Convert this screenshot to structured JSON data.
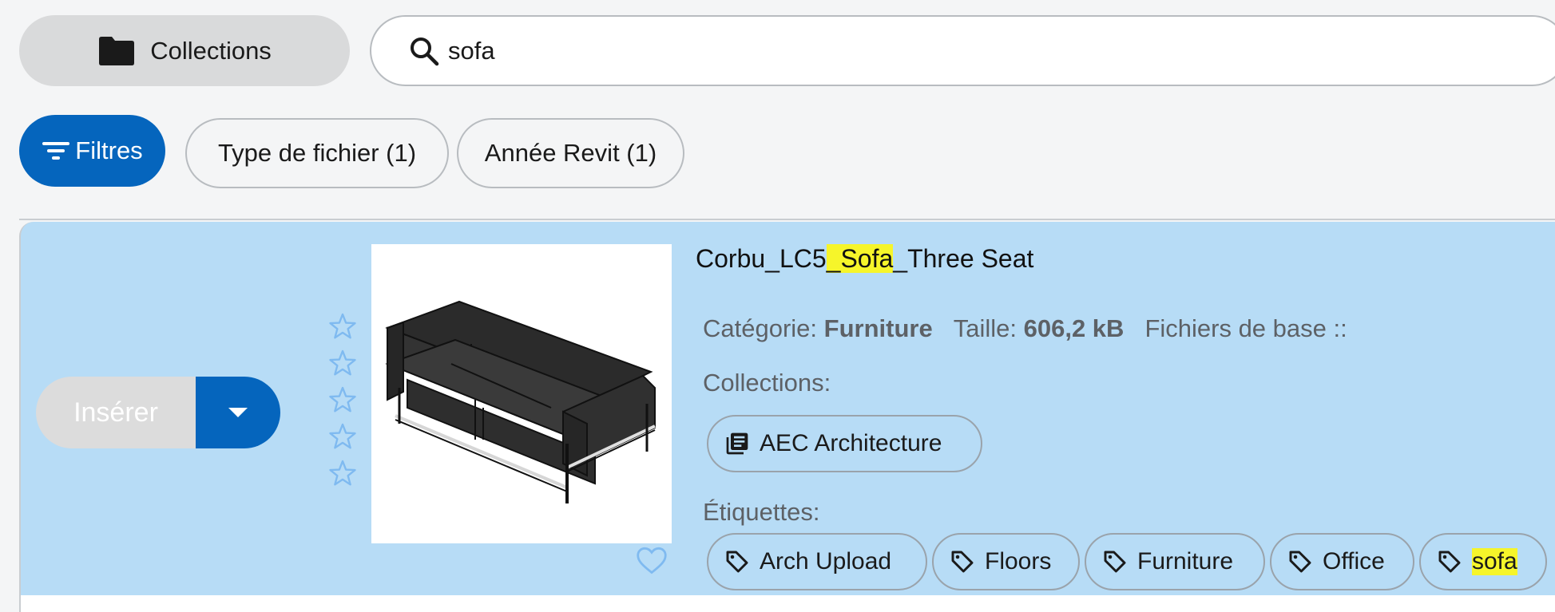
{
  "toolbar": {
    "collections_label": "Collections",
    "search_value": "sofa"
  },
  "filters": {
    "filters_label": "Filtres",
    "file_type_chip": "Type de fichier (1)",
    "revit_year_chip": "Année Revit (1)"
  },
  "result": {
    "title_prefix": "Corbu_LC5",
    "title_highlight": "_Sofa",
    "title_suffix": "_Three Seat",
    "insert_label": "Insérer",
    "category_label": "Catégorie:",
    "category_value": "Furniture",
    "size_label": "Taille:",
    "size_value": "606,2 kB",
    "base_files_label": "Fichiers de base ::",
    "collections_label": "Collections:",
    "collections": [
      "AEC Architecture"
    ],
    "tags_label": "Étiquettes:",
    "tags": [
      "Arch Upload",
      "Floors",
      "Furniture",
      "Office",
      "sofa"
    ],
    "highlighted_tag": "sofa",
    "rating": 0,
    "rating_max": 5
  },
  "colors": {
    "accent": "#0565bd",
    "card_background": "#b7dcf6",
    "highlight": "#f6f52a"
  },
  "icons": {
    "collections": "folder-icon",
    "search": "search-icon",
    "filters": "filter-lines-icon",
    "insert_dropdown": "caret-down-icon",
    "rating": "star-outline-icon",
    "favorite": "heart-outline-icon",
    "collection_chip": "library-book-icon",
    "tag": "tag-icon"
  }
}
